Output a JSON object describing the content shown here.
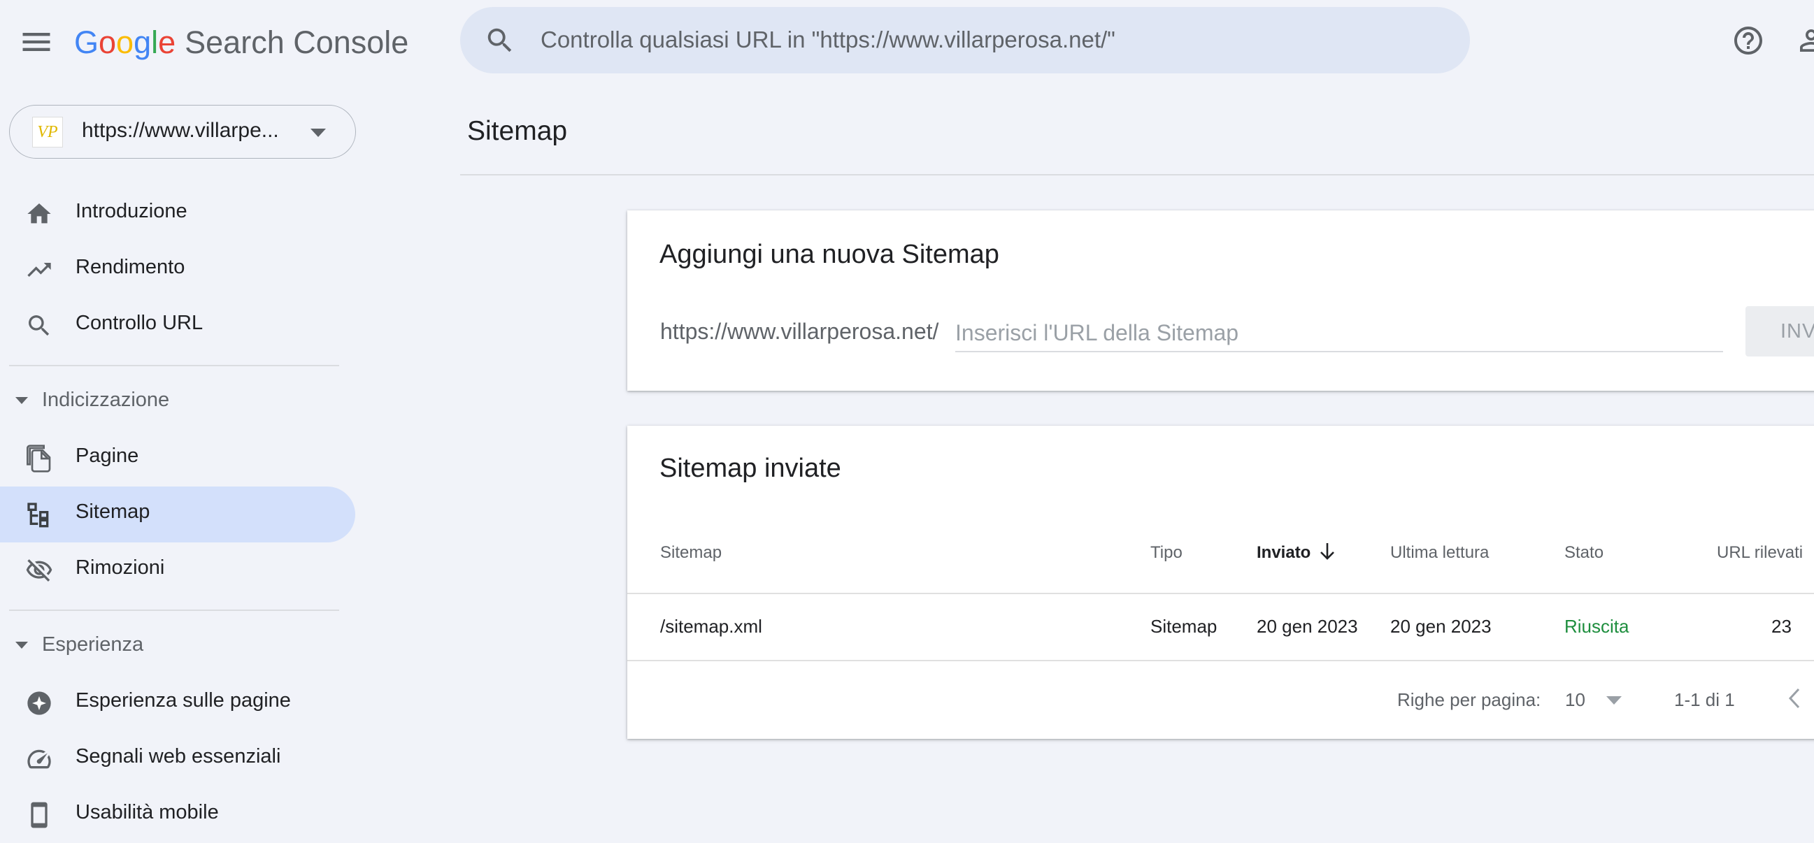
{
  "header": {
    "logo_letters": [
      "G",
      "o",
      "o",
      "g",
      "l",
      "e"
    ],
    "product": "Search Console",
    "search_placeholder": "Controlla qualsiasi URL in \"https://www.villarperosa.net/\""
  },
  "property": {
    "favicon_text": "VP",
    "label": "https://www.villarpe..."
  },
  "nav": {
    "introduzione": "Introduzione",
    "rendimento": "Rendimento",
    "controllo_url": "Controllo URL",
    "section_indicizzazione": "Indicizzazione",
    "pagine": "Pagine",
    "sitemap": "Sitemap",
    "rimozioni": "Rimozioni",
    "section_esperienza": "Esperienza",
    "esperienza_pagine": "Esperienza sulle pagine",
    "segnali_web": "Segnali web essenziali",
    "usabilita_mobile": "Usabilità mobile"
  },
  "main": {
    "title": "Sitemap",
    "add_card": {
      "title": "Aggiungi una nuova Sitemap",
      "prefix": "https://www.villarperosa.net/",
      "placeholder": "Inserisci l'URL della Sitemap",
      "submit": "INVIA"
    },
    "sent_card": {
      "title": "Sitemap inviate",
      "columns": {
        "sitemap": "Sitemap",
        "tipo": "Tipo",
        "inviato": "Inviato",
        "ultima_lettura": "Ultima lettura",
        "stato": "Stato",
        "url_rilevati": "URL rilevati"
      },
      "rows": [
        {
          "sitemap": "/sitemap.xml",
          "tipo": "Sitemap",
          "inviato": "20 gen 2023",
          "ultima_lettura": "20 gen 2023",
          "stato": "Riuscita",
          "url_rilevati": "23"
        }
      ],
      "pagination": {
        "rows_label": "Righe per pagina:",
        "rows_value": "10",
        "range": "1-1 di 1"
      }
    }
  },
  "colors": {
    "accent": "#d3e0fb",
    "success": "#1e8e3e",
    "background": "#f1f3f9"
  }
}
